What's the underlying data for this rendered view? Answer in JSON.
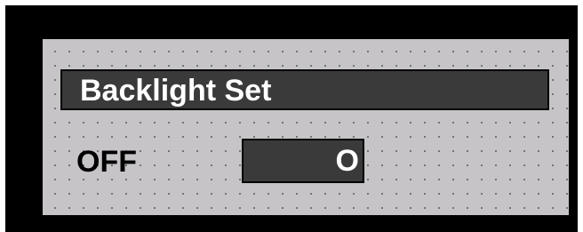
{
  "panel": {
    "title": "Backlight Set",
    "status_label": "OFF",
    "value": "O"
  },
  "colors": {
    "bezel": "#000000",
    "screen_background": "#c6c4c7",
    "dot_grid": "#5e5e5e",
    "field_background": "#3a3a3a",
    "field_text": "#ffffff",
    "label_text": "#000000"
  }
}
